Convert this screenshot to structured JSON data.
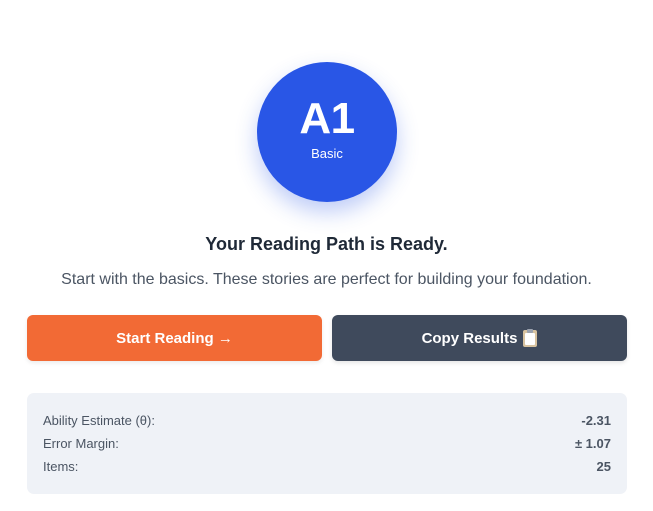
{
  "level": {
    "code": "A1",
    "name": "Basic",
    "color": "#2956e6"
  },
  "headline": "Your Reading Path is Ready.",
  "subtext": "Start with the basics. These stories are perfect for building your foundation.",
  "buttons": {
    "start_label": "Start Reading →",
    "start_color": "#f26a35",
    "copy_label": "Copy Results",
    "copy_icon": "clipboard-icon",
    "copy_color": "#3f4a5c"
  },
  "stats": [
    {
      "label": "Ability Estimate (θ):",
      "value": "-2.31"
    },
    {
      "label": "Error Margin:",
      "value": "± 1.07"
    },
    {
      "label": "Items:",
      "value": "25"
    }
  ]
}
